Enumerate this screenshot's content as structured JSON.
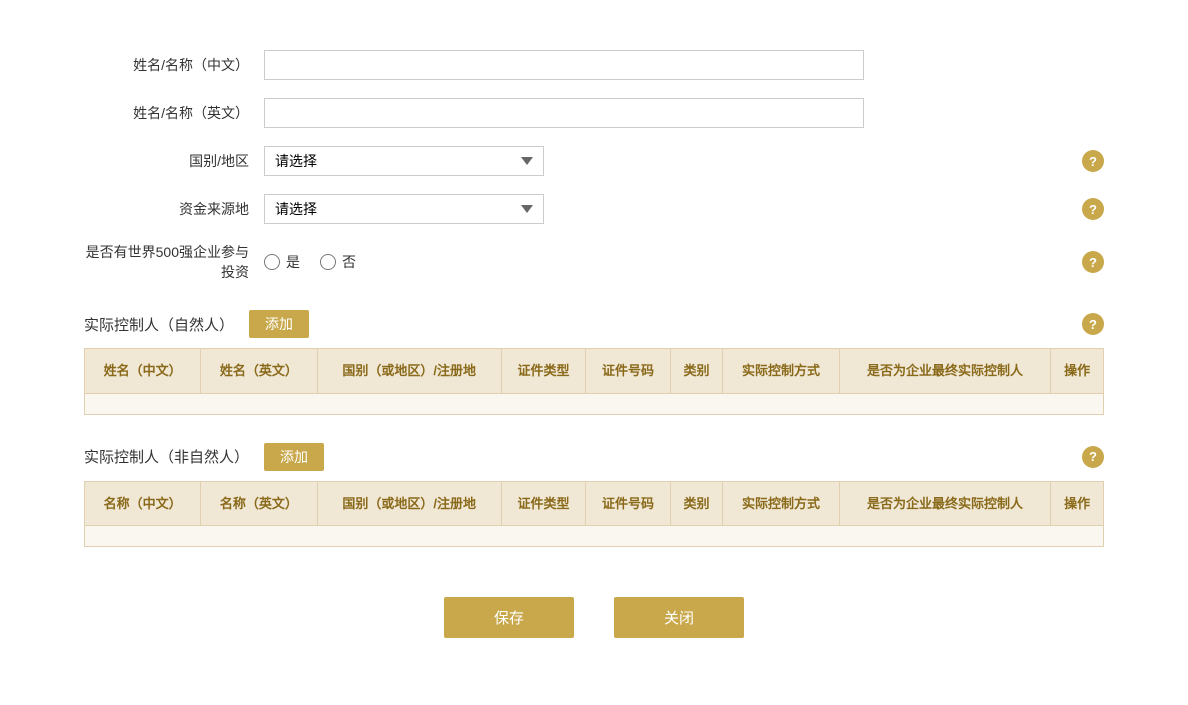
{
  "form": {
    "name_cn_label": "姓名/名称（中文）",
    "name_en_label": "姓名/名称（英文）",
    "country_label": "国别/地区",
    "country_placeholder": "请选择",
    "fund_source_label": "资金来源地",
    "fund_source_placeholder": "请选择",
    "fortune500_label": "是否有世界500强企业参与投资",
    "fortune500_yes": "是",
    "fortune500_no": "否"
  },
  "section1": {
    "title": "实际控制人（自然人）",
    "add_label": "添加",
    "columns": [
      "姓名（中文）",
      "姓名（英文）",
      "国别（或地区）/注册地",
      "证件类型",
      "证件号码",
      "类别",
      "实际控制方式",
      "是否为企业最终实际控制人",
      "操作"
    ]
  },
  "section2": {
    "title": "实际控制人（非自然人）",
    "add_label": "添加",
    "columns": [
      "名称（中文）",
      "名称（英文）",
      "国别（或地区）/注册地",
      "证件类型",
      "证件号码",
      "类别",
      "实际控制方式",
      "是否为企业最终实际控制人",
      "操作"
    ]
  },
  "footer": {
    "save_label": "保存",
    "close_label": "关闭"
  },
  "help_icon_text": "?",
  "colors": {
    "gold": "#c8a84b",
    "table_header_bg": "#f0e8d5",
    "table_header_text": "#8a6a1a"
  }
}
